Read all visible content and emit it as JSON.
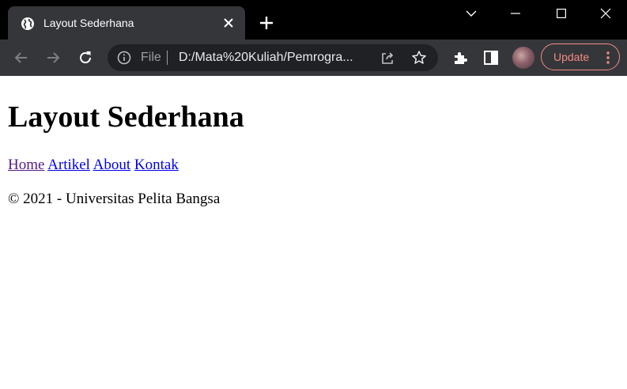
{
  "browser": {
    "tab": {
      "title": "Layout Sederhana",
      "favicon": "globe-icon"
    },
    "address_bar": {
      "scheme": "File",
      "url": "D:/Mata%20Kuliah/Pemrogra..."
    },
    "update_label": "Update",
    "accent_color": "#f28b82"
  },
  "page": {
    "heading": "Layout Sederhana",
    "nav": [
      {
        "label": "Home",
        "visited": true
      },
      {
        "label": "Artikel",
        "visited": false
      },
      {
        "label": "About",
        "visited": false
      },
      {
        "label": "Kontak",
        "visited": false
      }
    ],
    "footer": "© 2021 - Universitas Pelita Bangsa"
  }
}
